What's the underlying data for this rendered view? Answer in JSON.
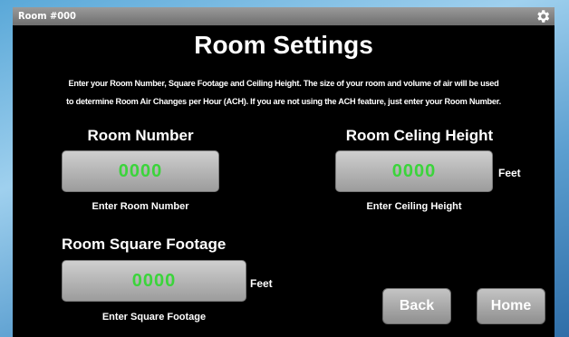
{
  "window": {
    "title": "Room #000",
    "settings_icon": "gear-icon"
  },
  "heading": "Room Settings",
  "description": {
    "line1": "Enter your Room Number, Square Footage and Ceiling Height. The size of your room and volume of air will be used",
    "line2": "to determine Room Air Changes per Hour (ACH). If you are not using the ACH feature, just enter your Room Number."
  },
  "room_number": {
    "label": "Room Number",
    "value": "0000",
    "hint": "Enter Room Number"
  },
  "ceiling_height": {
    "label": "Room Celing Height",
    "value": "0000",
    "unit": "Feet",
    "hint": "Enter Ceiling Height"
  },
  "square_footage": {
    "label": "Room Square Footage",
    "value": "0000",
    "unit": "Feet",
    "hint": "Enter Square Footage"
  },
  "buttons": {
    "back": "Back",
    "home": "Home"
  },
  "colors": {
    "value_text": "#3bd43b",
    "screen_bg": "#000000"
  }
}
